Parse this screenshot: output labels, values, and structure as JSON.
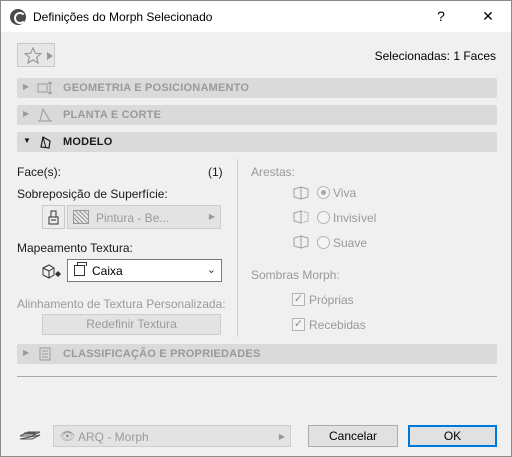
{
  "window": {
    "title": "Definições do Morph Selecionado",
    "help_label": "?",
    "close_label": "✕"
  },
  "header": {
    "selected_text": "Selecionadas: 1 Faces"
  },
  "panels": {
    "geometry": "GEOMETRIA E POSICIONAMENTO",
    "plan": "PLANTA E CORTE",
    "model": "MODELO",
    "classification": "CLASSIFICAÇÃO E PROPRIEDADES"
  },
  "model": {
    "faces_label": "Face(s):",
    "faces_count": "(1)",
    "surface_override_label": "Sobreposição de Superfície:",
    "surface_value": "Pintura - Be...",
    "texture_mapping_label": "Mapeamento Textura:",
    "texture_mapping_value": "Caixa",
    "custom_alignment_label": "Alinhamento de Textura Personalizada:",
    "redefine_texture_label": "Redefinir Textura",
    "edges_label": "Arestas:",
    "edge_options": [
      {
        "label": "Viva",
        "selected": true
      },
      {
        "label": "Invisível",
        "selected": false
      },
      {
        "label": "Suave",
        "selected": false
      }
    ],
    "shadows_label": "Sombras Morph:",
    "shadow_options": [
      {
        "label": "Próprias",
        "checked": true
      },
      {
        "label": "Recebidas",
        "checked": true
      }
    ]
  },
  "footer": {
    "layer_value": "ARQ - Morph",
    "cancel_label": "Cancelar",
    "ok_label": "OK"
  },
  "colors": {
    "accent": "#0078d7",
    "panel_bg": "#dadada",
    "disabled_text": "#9a9a9a"
  }
}
